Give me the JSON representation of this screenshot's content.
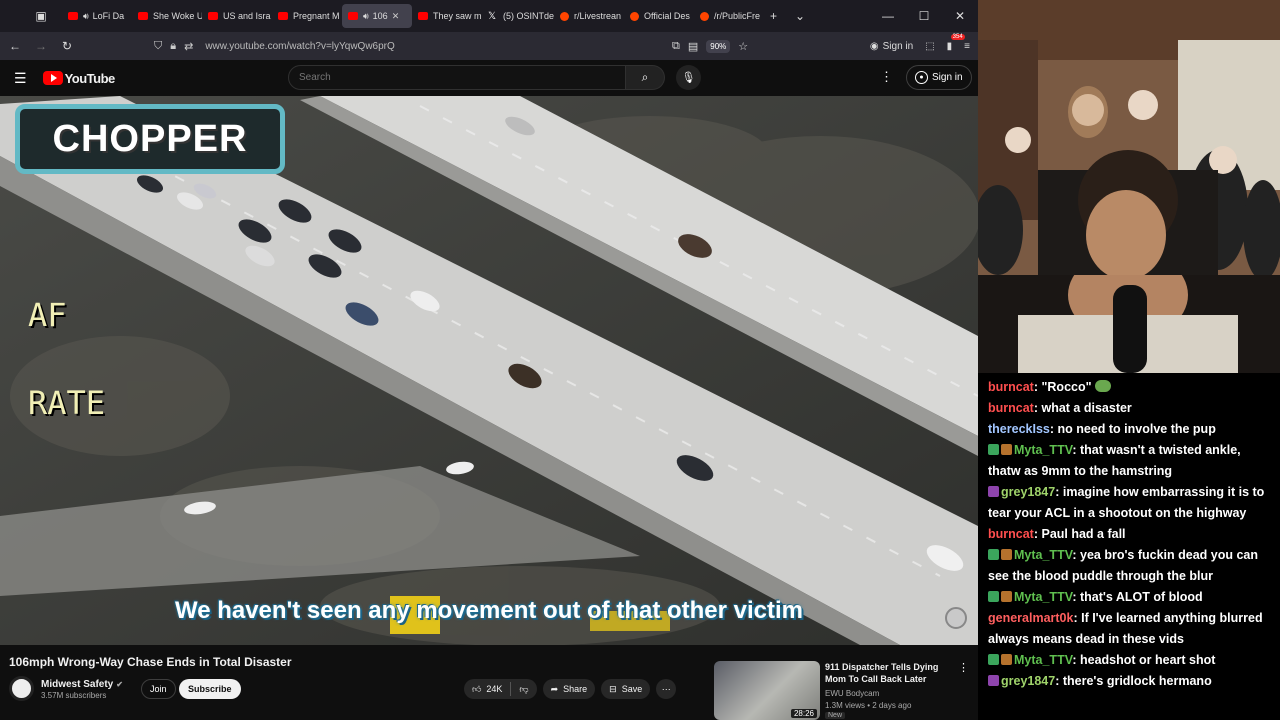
{
  "browser": {
    "tabs": [
      {
        "label": "LoFi Da",
        "active": false
      },
      {
        "label": "She Woke U",
        "active": false
      },
      {
        "label": "US and Isra",
        "active": false
      },
      {
        "label": "Pregnant M",
        "active": false
      },
      {
        "label": "106",
        "active": true
      },
      {
        "label": "They saw m",
        "active": false
      },
      {
        "label": "(5) OSINTde",
        "active": false
      },
      {
        "label": "r/Livestrean",
        "active": false
      },
      {
        "label": "Official Des",
        "active": false
      },
      {
        "label": "/r/PublicFre",
        "active": false
      }
    ],
    "url": "www.youtube.com/watch?v=lyYqwQw6prQ",
    "zoom": "90%",
    "signin_label": "Sign in",
    "notification_count": "354"
  },
  "youtube": {
    "logo_text": "YouTube",
    "search_placeholder": "Search",
    "signin_label": "Sign in"
  },
  "video": {
    "overlay_logo": "CHOPPER",
    "hud_top": "AF",
    "hud_bottom": "RATE",
    "caption": "We haven't seen any movement out of that other victim"
  },
  "video_info": {
    "title": "106mph Wrong-Way Chase Ends in Total Disaster",
    "channel": "Midwest Safety",
    "subscribers": "3.57M subscribers",
    "join_label": "Join",
    "subscribe_label": "Subscribe",
    "likes": "24K",
    "share_label": "Share",
    "save_label": "Save"
  },
  "recommendation": {
    "title": "911 Dispatcher Tells Dying Mom To Call Back Later",
    "channel": "EWU Bodycam",
    "meta": "1.3M views • 2 days ago",
    "duration": "28:26",
    "tag": "New"
  },
  "chat": [
    {
      "user": "burncat",
      "color": "#ff4f4f",
      "text": ": \"Rocco\"",
      "badges": [],
      "emote": true
    },
    {
      "user": "burncat",
      "color": "#ff4f4f",
      "text": ": what a disaster",
      "badges": [],
      "emote": false
    },
    {
      "user": "thereckIss",
      "color": "#a2c6ff",
      "text": ": no need to involve the pup",
      "badges": [],
      "emote": false
    },
    {
      "user": "Myta_TTV",
      "color": "#5fbf4f",
      "text": ": that wasn't a twisted ankle, thatw as 9mm to the hamstring",
      "badges": [
        "#3ba55c",
        "#b5722d"
      ],
      "emote": false
    },
    {
      "user": "grey1847",
      "color": "#9fd36a",
      "text": ": imagine how embarrassing it is to tear your ACL in a shootout on the highway",
      "badges": [
        "#8e44ad"
      ],
      "emote": false
    },
    {
      "user": "burncat",
      "color": "#ff4f4f",
      "text": ": Paul had a fall",
      "badges": [],
      "emote": false
    },
    {
      "user": "Myta_TTV",
      "color": "#5fbf4f",
      "text": ": yea bro's fuckin dead you can see the blood puddle through the blur",
      "badges": [
        "#3ba55c",
        "#b5722d"
      ],
      "emote": false
    },
    {
      "user": "Myta_TTV",
      "color": "#5fbf4f",
      "text": ": that's ALOT of blood",
      "badges": [
        "#3ba55c",
        "#b5722d"
      ],
      "emote": false
    },
    {
      "user": "generalmart0k",
      "color": "#ff5f5f",
      "text": ": If I've learned anything blurred always means dead in these vids",
      "badges": [],
      "emote": false
    },
    {
      "user": "Myta_TTV",
      "color": "#5fbf4f",
      "text": ": headshot or heart shot",
      "badges": [
        "#3ba55c",
        "#b5722d"
      ],
      "emote": false
    },
    {
      "user": "grey1847",
      "color": "#9fd36a",
      "text": ": there's gridlock hermano",
      "badges": [
        "#8e44ad"
      ],
      "emote": false
    }
  ]
}
